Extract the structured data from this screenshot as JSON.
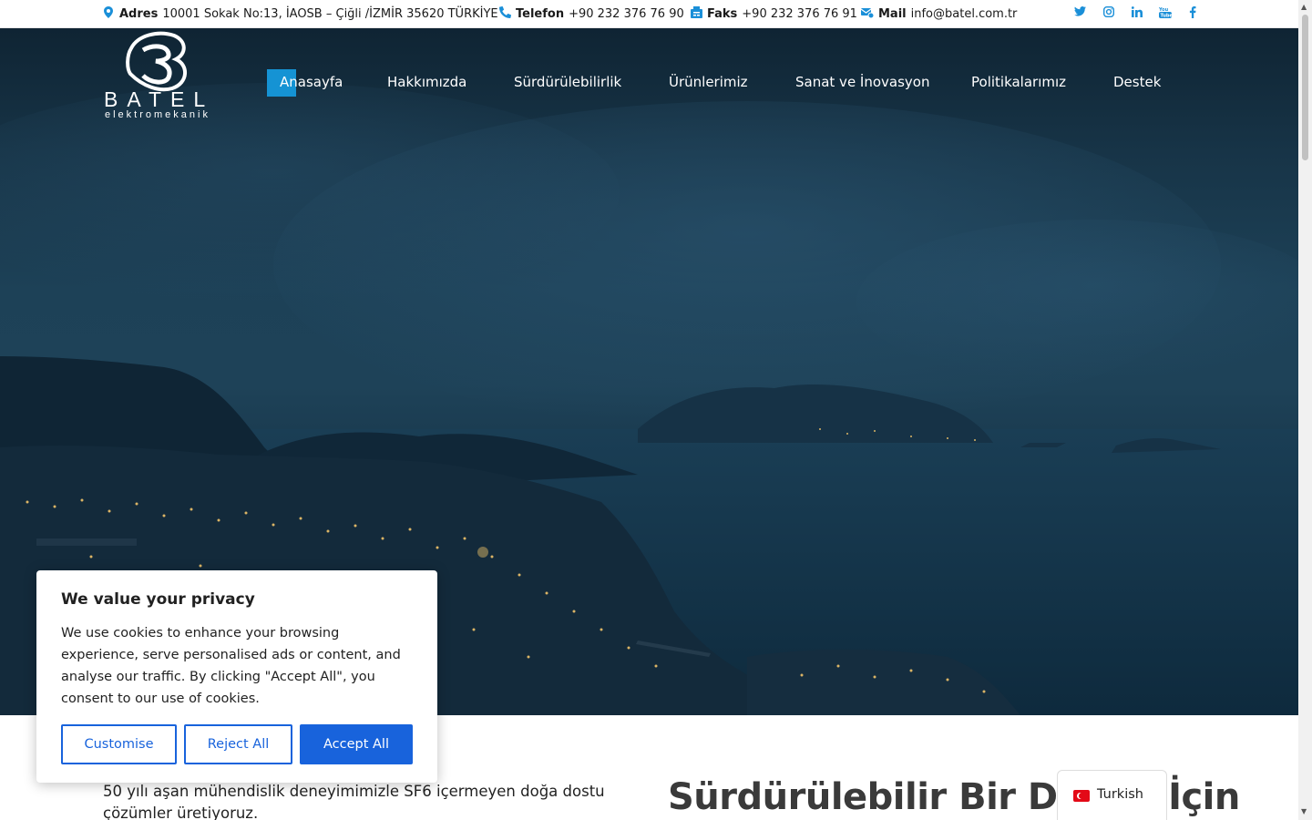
{
  "topbar": {
    "address": {
      "label": "Adres",
      "value": "10001 Sokak No:13, İAOSB – Çiğli /İZMİR 35620 TÜRKİYE"
    },
    "phone": {
      "label": "Telefon",
      "value": "+90 232 376 76 90"
    },
    "fax": {
      "label": "Faks",
      "value": "+90 232 376 76 91"
    },
    "mail": {
      "label": "Mail",
      "value": "info@batel.com.tr"
    },
    "social": [
      "twitter-icon",
      "instagram-icon",
      "linkedin-icon",
      "youtube-icon",
      "facebook-icon"
    ]
  },
  "logo": {
    "name": "BATEL",
    "subtitle": "elektromekanik"
  },
  "nav": {
    "items": [
      "Anasayfa",
      "Hakkımızda",
      "Sürdürülebilirlik",
      "Ürünlerimiz",
      "Sanat ve İnovasyon",
      "Politikalarımız",
      "Destek"
    ],
    "active_index": 0
  },
  "content": {
    "intro": "50 yılı aşan mühendislik deneyimimizle SF6 içermeyen doğa dostu çözümler üretiyoruz.",
    "heading": "Sürdürülebilir Bir Dünya İçin"
  },
  "cookie": {
    "title": "We value your privacy",
    "body": "We use cookies to enhance your browsing experience, serve personalised ads or content, and analyse our traffic. By clicking \"Accept All\", you consent to our use of cookies.",
    "customise": "Customise",
    "reject": "Reject All",
    "accept": "Accept All"
  },
  "language": {
    "label": "Turkish"
  },
  "colors": {
    "accent": "#1593d4",
    "cookie_button": "#1863dc",
    "icon": "#1a8fd8"
  }
}
